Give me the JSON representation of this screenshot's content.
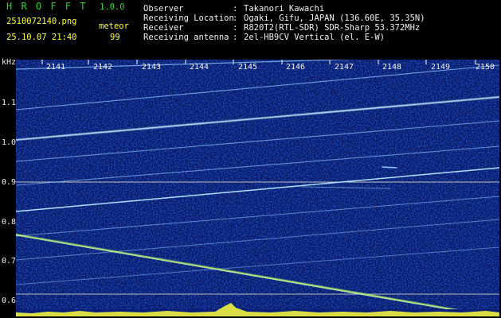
{
  "app": {
    "name": "H R O F F T",
    "version": "1.0.0"
  },
  "file": {
    "filename": "2510072140.png",
    "datetime": "25.10.07 21:40"
  },
  "meteor": {
    "label": "meteor",
    "count": "99"
  },
  "info": [
    {
      "key": "Observer",
      "sep": ":",
      "value": "Takanori Kawachi"
    },
    {
      "key": "Receiving Location",
      "sep": ":",
      "value": "Ogaki, Gifu, JAPAN (136.60E, 35.35N)"
    },
    {
      "key": "Receiver",
      "sep": ":",
      "value": "R820T2(RTL-SDR) SDR-Sharp 53.372MHz"
    },
    {
      "key": "Receiving antenna",
      "sep": ":",
      "value": "2el-HB9CV Vertical (el. E-W)"
    }
  ],
  "axis": {
    "y_unit": "kHz",
    "y_ticks": [
      "1.1",
      "1.0",
      "0.9",
      "0.8",
      "0.7",
      "0.6"
    ],
    "x_ticks": [
      "2141",
      "2142",
      "2143",
      "2144",
      "2145",
      "2146",
      "2147",
      "2148",
      "2149",
      "2150"
    ]
  },
  "colors": {
    "background": "#000000",
    "waterfall": "#0a1f78",
    "trace": "#9cd8ff",
    "meteor_trace": "#b8ff70",
    "marker_line": "#bfbfbf",
    "title": "#27d627",
    "label": "#ffff3a",
    "text": "#f2f2f2"
  }
}
